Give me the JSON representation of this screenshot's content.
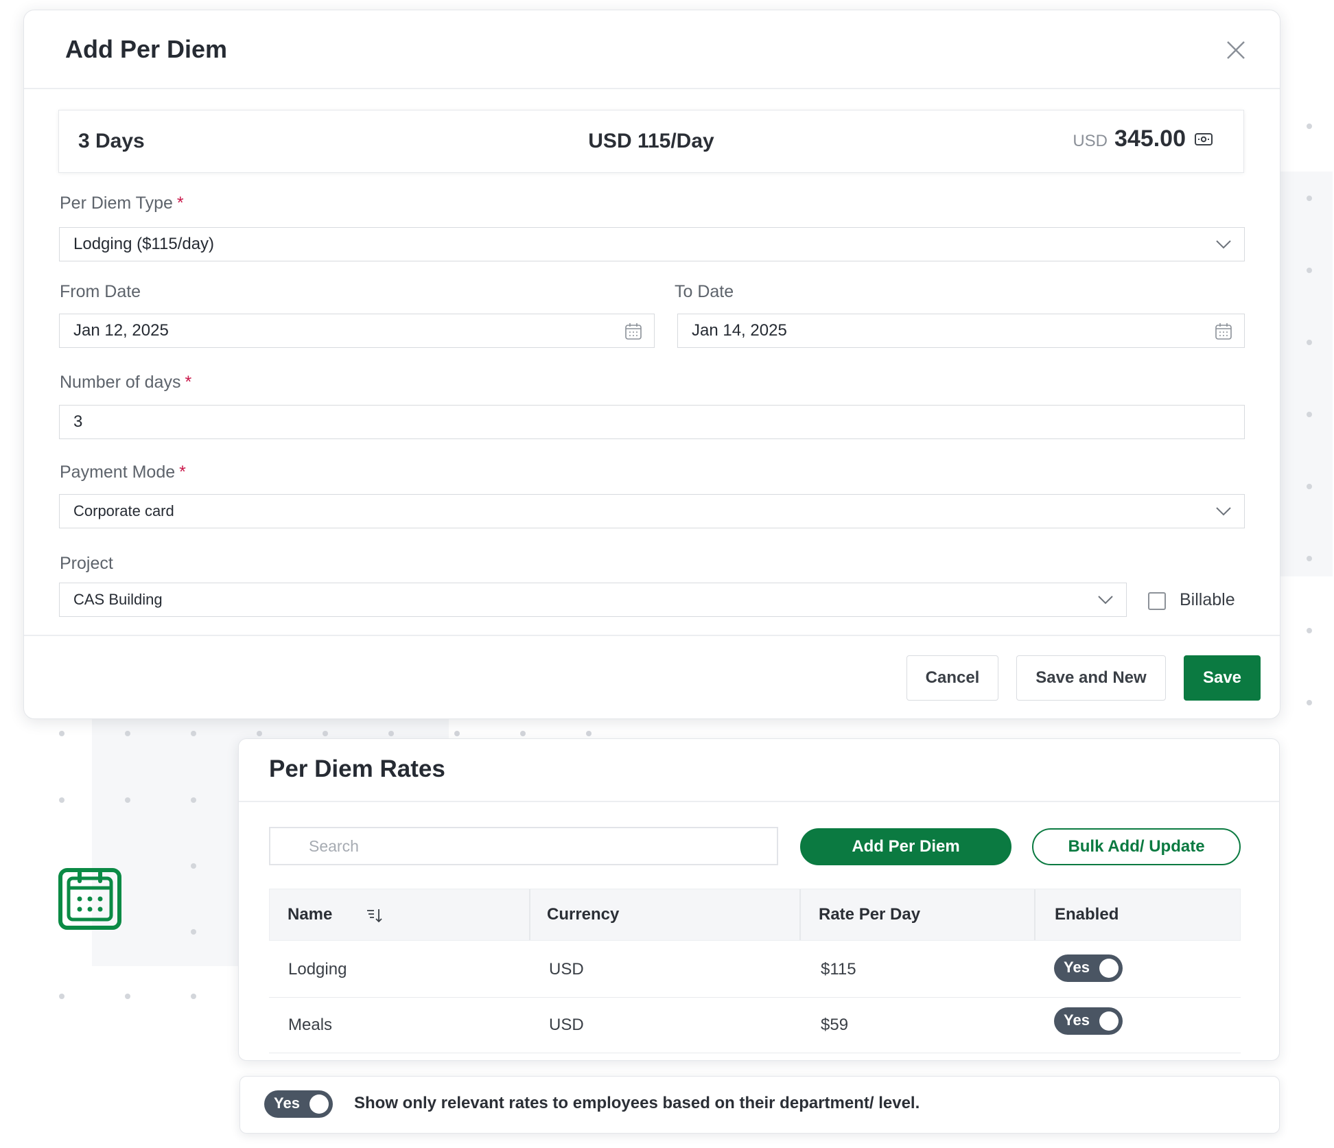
{
  "modal": {
    "title": "Add Per Diem",
    "summary": {
      "days": "3 Days",
      "rate": "USD 115/Day",
      "total_currency": "USD",
      "total_amount": "345.00"
    },
    "fields": {
      "per_diem_type": {
        "label": "Per Diem Type",
        "required": "*",
        "value": "Lodging ($115/day)"
      },
      "from_date": {
        "label": "From Date",
        "value": "Jan 12, 2025"
      },
      "to_date": {
        "label": "To Date",
        "value": "Jan 14, 2025"
      },
      "number_of_days": {
        "label": "Number of days",
        "required": "*",
        "value": "3"
      },
      "payment_mode": {
        "label": "Payment Mode",
        "required": "*",
        "value": "Corporate card"
      },
      "project": {
        "label": "Project",
        "value": "CAS Building"
      },
      "billable": {
        "label": "Billable",
        "checked": false
      }
    },
    "buttons": {
      "cancel": "Cancel",
      "save_and_new": "Save and New",
      "save": "Save"
    }
  },
  "rates": {
    "title": "Per Diem Rates",
    "search_placeholder": "Search",
    "add_button": "Add Per Diem",
    "bulk_button": "Bulk Add/ Update",
    "columns": [
      "Name",
      "Currency",
      "Rate Per Day",
      "Enabled"
    ],
    "rows": [
      {
        "name": "Lodging",
        "currency": "USD",
        "rate": "$115",
        "enabled": "Yes"
      },
      {
        "name": "Meals",
        "currency": "USD",
        "rate": "$59",
        "enabled": "Yes"
      }
    ]
  },
  "bottom": {
    "toggle_label": "Yes",
    "text": "Show only relevant rates to employees based on their department/ level."
  },
  "colors": {
    "primary_green": "#0b7a41",
    "required_red": "#c9184a",
    "toggle_dark": "#4a5563"
  },
  "icons": {
    "close": "close-icon",
    "chevron": "chevron-down-icon",
    "calendar": "calendar-icon",
    "money": "money-icon",
    "sort": "sort-icon",
    "search": "search-icon",
    "app": "calendar-app-icon"
  }
}
